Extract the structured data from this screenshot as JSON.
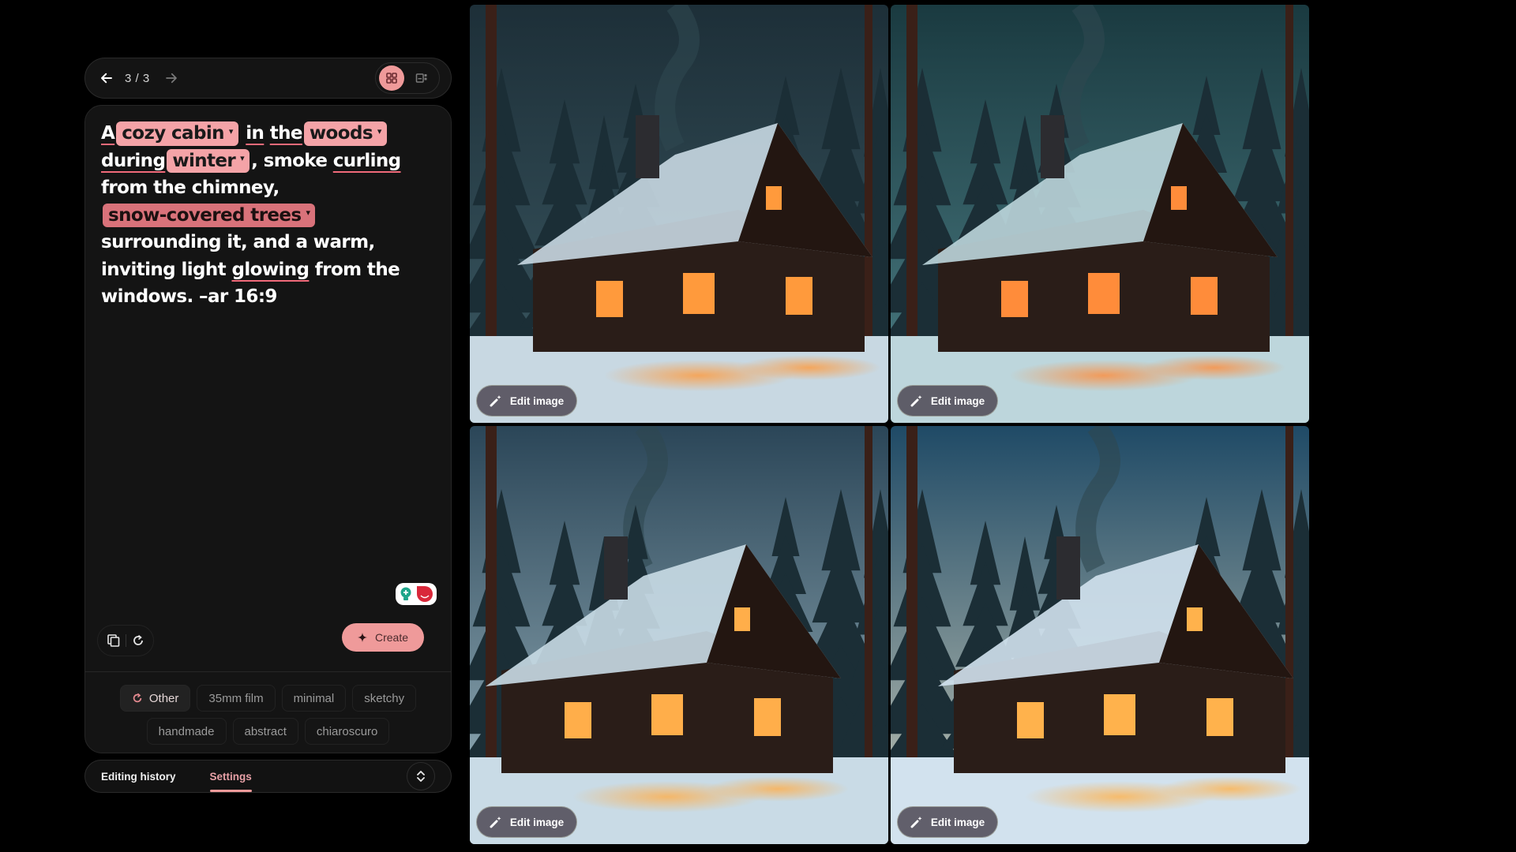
{
  "nav": {
    "back_icon": "arrow-left-icon",
    "page_count": "3 / 3",
    "forward_icon": "arrow-right-icon",
    "views": [
      {
        "name": "grid-view",
        "icon": "grid-icon",
        "active": true
      },
      {
        "name": "single-view",
        "icon": "single-image-icon",
        "active": false
      }
    ]
  },
  "prompt": {
    "segments": [
      {
        "type": "text",
        "text": "A",
        "underline": true
      },
      {
        "type": "chip",
        "text": "cozy cabin"
      },
      {
        "type": "text",
        "text": " "
      },
      {
        "type": "text",
        "text": "in",
        "underline": true
      },
      {
        "type": "text",
        "text": " "
      },
      {
        "type": "text",
        "text": "the",
        "underline": true
      },
      {
        "type": "chip",
        "text": "woods"
      },
      {
        "type": "text",
        "text": " "
      },
      {
        "type": "text",
        "text": "during",
        "underline": true
      },
      {
        "type": "chip",
        "text": "winter"
      },
      {
        "type": "text",
        "text": ", smoke "
      },
      {
        "type": "text",
        "text": "curling",
        "underline": true
      },
      {
        "type": "text",
        "text": " from the chimney, "
      },
      {
        "type": "chip",
        "text": "snow-covered trees",
        "variant": "dark"
      },
      {
        "type": "text",
        "text": " surrounding it, and a warm, inviting light "
      },
      {
        "type": "text",
        "text": "glowing",
        "underline": true
      },
      {
        "type": "text",
        "text": " from the windows. –ar 16:9"
      }
    ],
    "accent_color": "#ef9a9a",
    "underline_color": "#f06a7a"
  },
  "actions": {
    "copy_icon": "copy-icon",
    "reset_icon": "refresh-icon",
    "create_label": "Create",
    "create_icon": "sparkle-icon"
  },
  "styles": {
    "rows": [
      [
        {
          "label": "Other",
          "active": true,
          "icon": "refresh-icon"
        },
        {
          "label": "35mm film"
        },
        {
          "label": "minimal"
        },
        {
          "label": "sketchy"
        }
      ],
      [
        {
          "label": "handmade"
        },
        {
          "label": "abstract"
        },
        {
          "label": "chiaroscuro"
        }
      ]
    ]
  },
  "tabs": {
    "items": [
      {
        "label": "Editing history",
        "active": false
      },
      {
        "label": "Settings",
        "active": true
      }
    ],
    "expand_icon": "unfold-icon"
  },
  "images": [
    {
      "edit_label": "Edit image",
      "sky": [
        "#1d2f38",
        "#3c5a64"
      ],
      "snow": "#c8d8e2",
      "glow": "#ff9a3c"
    },
    {
      "edit_label": "Edit image",
      "sky": [
        "#1a3a40",
        "#4d7f86"
      ],
      "snow": "#bdd6dc",
      "glow": "#ff8c3a"
    },
    {
      "edit_label": "Edit image",
      "sky": [
        "#2b4658",
        "#9cb6c0"
      ],
      "snow": "#c9dbe6",
      "glow": "#ffae4a"
    },
    {
      "edit_label": "Edit image",
      "sky": [
        "#1f4a66",
        "#c6c8b8"
      ],
      "snow": "#d2e2ee",
      "glow": "#ffb24c"
    }
  ]
}
